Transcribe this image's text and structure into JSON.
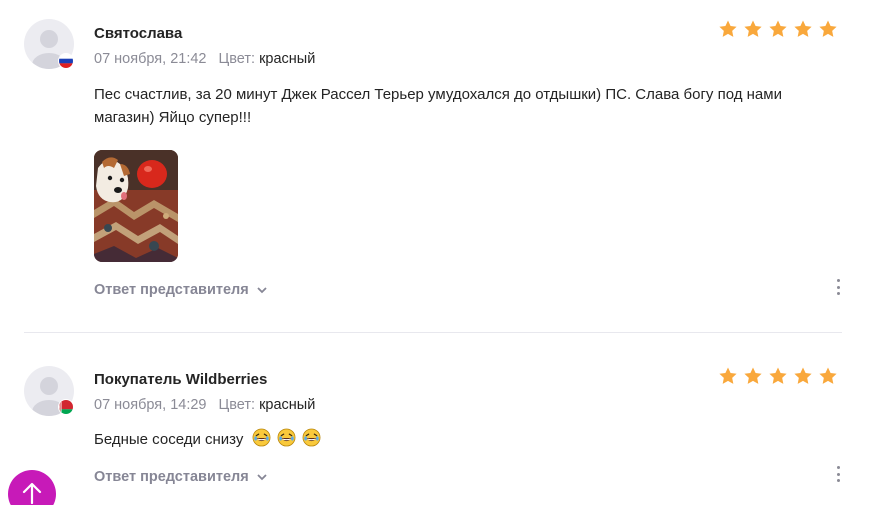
{
  "reviews": [
    {
      "author": "Святослава",
      "date": "07 ноября, 21:42",
      "color_label": "Цвет:",
      "color_value": "красный",
      "rating": 5,
      "flag": "russia-flag-icon",
      "text": "Пес счастлив, за 20 минут Джек Рассел Терьер умудохался до отдышки) ПС. Слава богу под нами магазин) Яйцо супер!!!",
      "has_photo": true,
      "reply_label": "Ответ представителя"
    },
    {
      "author": "Покупатель Wildberries",
      "date": "07 ноября, 14:29",
      "color_label": "Цвет:",
      "color_value": "красный",
      "rating": 5,
      "flag": "belarus-flag-icon",
      "text": "Бедные соседи снизу",
      "emoji_count": 3,
      "reply_label": "Ответ представителя"
    }
  ],
  "colors": {
    "star": "#f9a83c",
    "accent": "#c71ab8",
    "muted": "#8b8b96"
  }
}
